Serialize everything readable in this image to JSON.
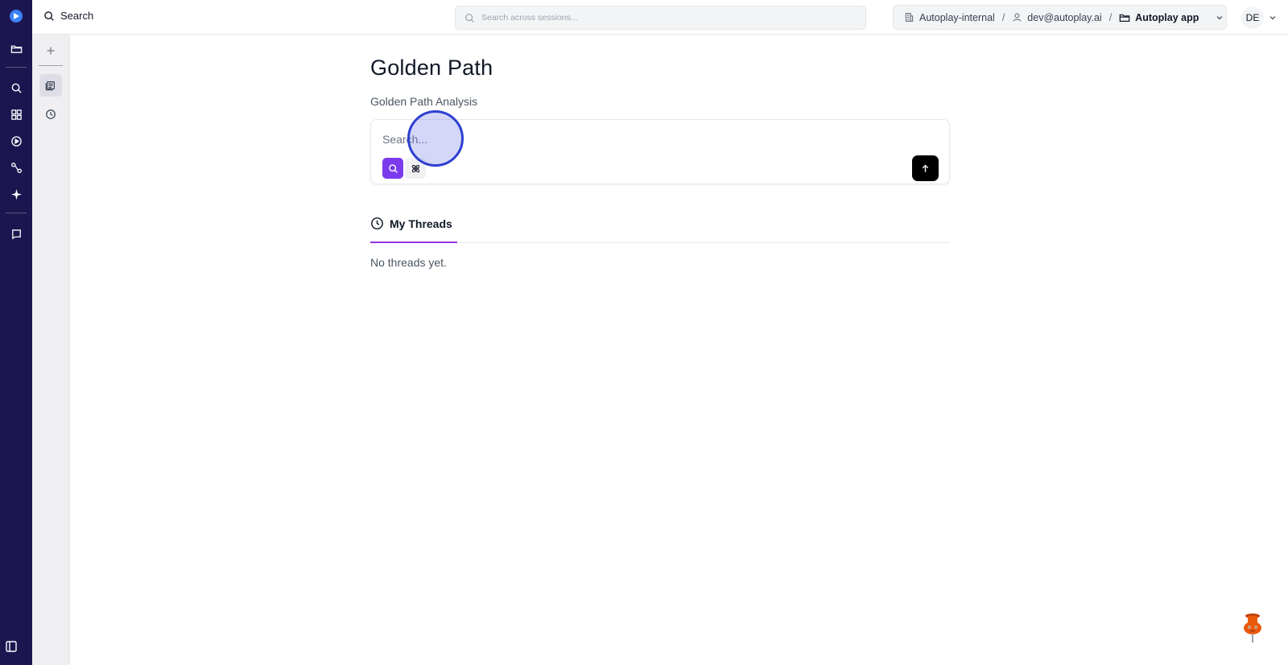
{
  "topbar": {
    "search_label": "Search",
    "global_search_placeholder": "Search across sessions...",
    "context": {
      "org": "Autoplay-internal",
      "user": "dev@autoplay.ai",
      "project": "Autoplay app",
      "separator": "/"
    },
    "avatar_initials": "DE"
  },
  "rail": {
    "icons": [
      "logo-icon",
      "folder-icon",
      "search-icon",
      "dashboard-icon",
      "play-icon",
      "flow-icon",
      "sparkle-icon",
      "chat-icon",
      "sidebar-toggle-icon"
    ]
  },
  "side": {
    "icons": [
      "plus-icon",
      "sessions-icon",
      "history-icon"
    ],
    "active": "sessions-icon"
  },
  "main": {
    "title": "Golden Path",
    "subtitle": "Golden Path Analysis",
    "composer": {
      "placeholder": "Search...",
      "modes": [
        "search",
        "insight"
      ],
      "active_mode": "search"
    },
    "tabs": [
      {
        "label": "My Threads",
        "icon": "clock-icon",
        "active": true
      }
    ],
    "empty_text": "No threads yet."
  },
  "colors": {
    "rail_bg": "#1c1650",
    "accent_purple": "#7c3aed",
    "tab_underline": "#9333ea",
    "send_button": "#000000"
  }
}
